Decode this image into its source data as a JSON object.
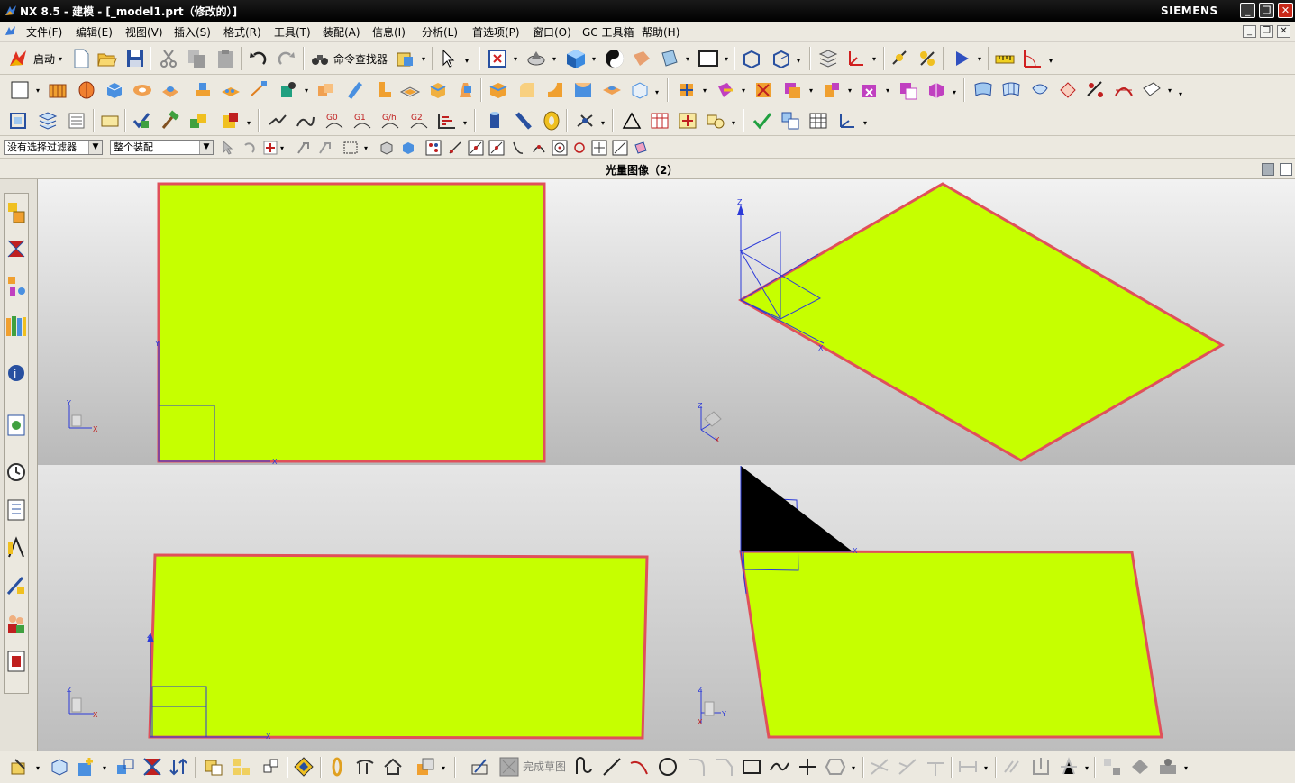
{
  "window": {
    "title": "NX 8.5 - 建模 - [_model1.prt（修改的）]",
    "brand": "SIEMENS",
    "minimize": "_",
    "restore": "❐",
    "close": "✕"
  },
  "menubar": {
    "items": [
      {
        "label": "文件(F)"
      },
      {
        "label": "编辑(E)"
      },
      {
        "label": "视图(V)"
      },
      {
        "label": "插入(S)"
      },
      {
        "label": "格式(R)"
      },
      {
        "label": "工具(T)"
      },
      {
        "label": "装配(A)"
      },
      {
        "label": "信息(I)"
      },
      {
        "label": "分析(L)"
      },
      {
        "label": "首选项(P)"
      },
      {
        "label": "窗口(O)"
      },
      {
        "label": "GC 工具箱"
      },
      {
        "label": "帮助(H)"
      }
    ]
  },
  "toolbar": {
    "start_label": "启动",
    "command_finder_label": "命令查找器"
  },
  "selection_bar": {
    "filter_value": "没有选择过滤器",
    "scope_value": "整个装配"
  },
  "view": {
    "title": "光量图像（2）"
  },
  "sketch_toolbar": {
    "finish_sketch_label": "完成草图"
  },
  "colors": {
    "sheet_fill": "#c6ff00",
    "sheet_edge": "#e0505a",
    "wcs_blue": "#2c3ad8",
    "axis_red": "#c02020",
    "bg_light": "#eaeaea",
    "bg_dark": "#b8b8b8"
  },
  "icons": {
    "app": "nx-app-icon",
    "resource_bar": [
      "assembly-navigator-icon",
      "constraint-navigator-icon",
      "part-navigator-icon",
      "reuse-library-icon",
      "hd3d-tools-icon",
      "web-browser-icon",
      "history-icon",
      "process-studio-icon",
      "visualization-icon",
      "manufacturing-wizard-icon",
      "roles-icon",
      "system-scenes-icon"
    ]
  }
}
